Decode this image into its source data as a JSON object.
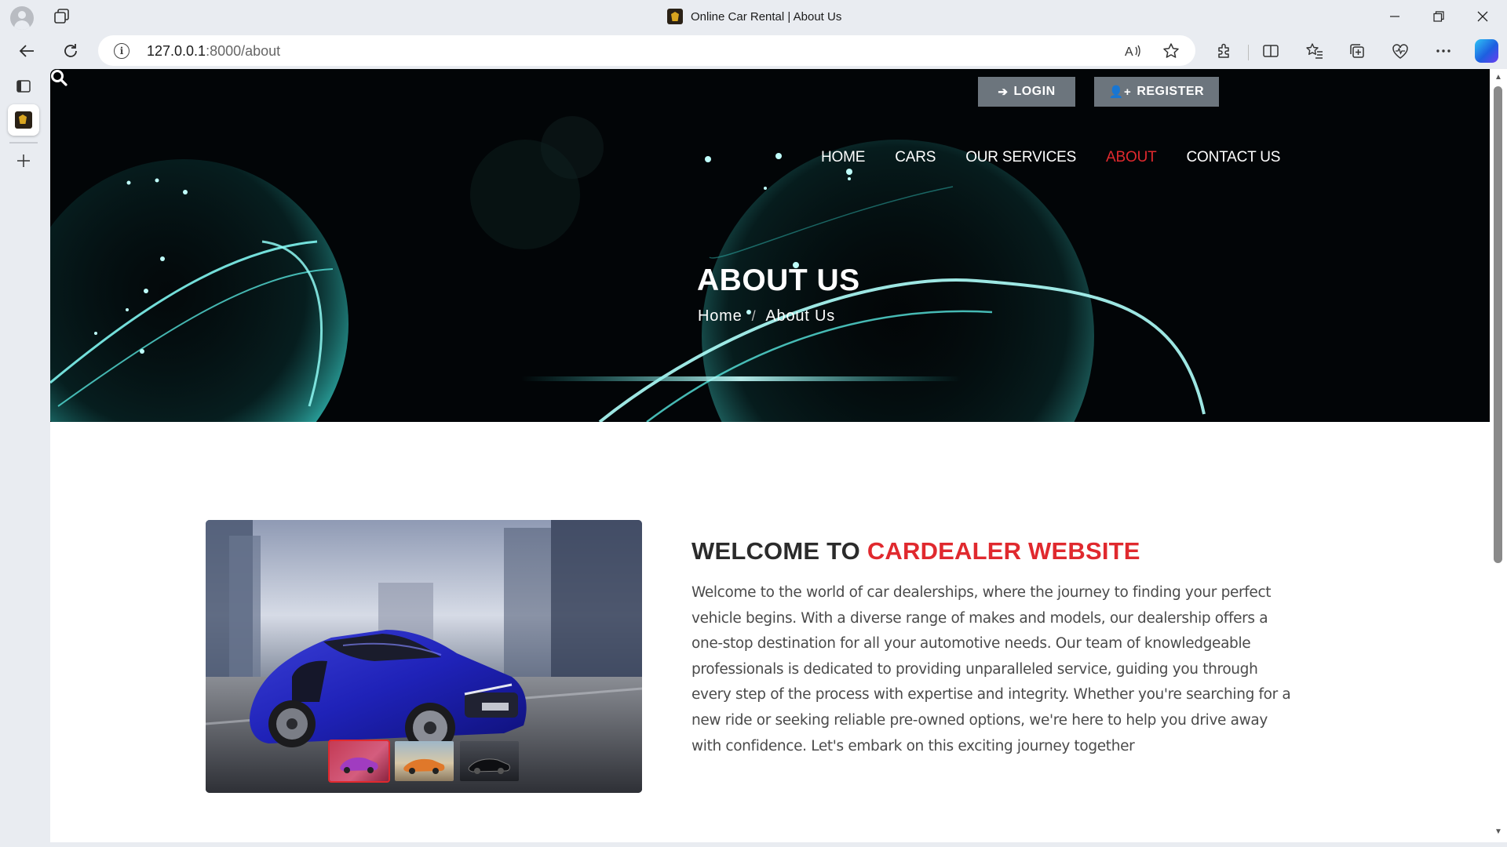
{
  "browser": {
    "tab_title": "Online Car Rental | About Us",
    "url_host": "127.0.0.1",
    "url_path": ":8000/about"
  },
  "header": {
    "login_label": "LOGIN",
    "register_label": "REGISTER",
    "nav": [
      {
        "label": "HOME"
      },
      {
        "label": "CARS"
      },
      {
        "label": "OUR SERVICES"
      },
      {
        "label": "ABOUT"
      },
      {
        "label": "CONTACT US"
      }
    ],
    "active_nav": "ABOUT"
  },
  "hero": {
    "title": "ABOUT US",
    "breadcrumb": [
      "Home",
      "About Us"
    ]
  },
  "about": {
    "heading_prefix": "WELCOME TO",
    "heading_accent": "CARDEALER WEBSITE",
    "body": "Welcome to the world of car dealerships, where the journey to finding your perfect vehicle begins. With a diverse range of makes and models, our dealership offers a one-stop destination for all your automotive needs. Our team of knowledgeable professionals is dedicated to providing unparalleled service, guiding you through every step of the process with expertise and integrity. Whether you're searching for a new ride or seeking reliable pre-owned options, we're here to help you drive away with confidence. Let's embark on this exciting journey together",
    "gallery_thumbnails": [
      "red car",
      "orange car",
      "black car"
    ]
  },
  "colors": {
    "accent": "#e0292e",
    "auth_button": "#6c757d",
    "hero_glow": "#4ee8e0"
  }
}
